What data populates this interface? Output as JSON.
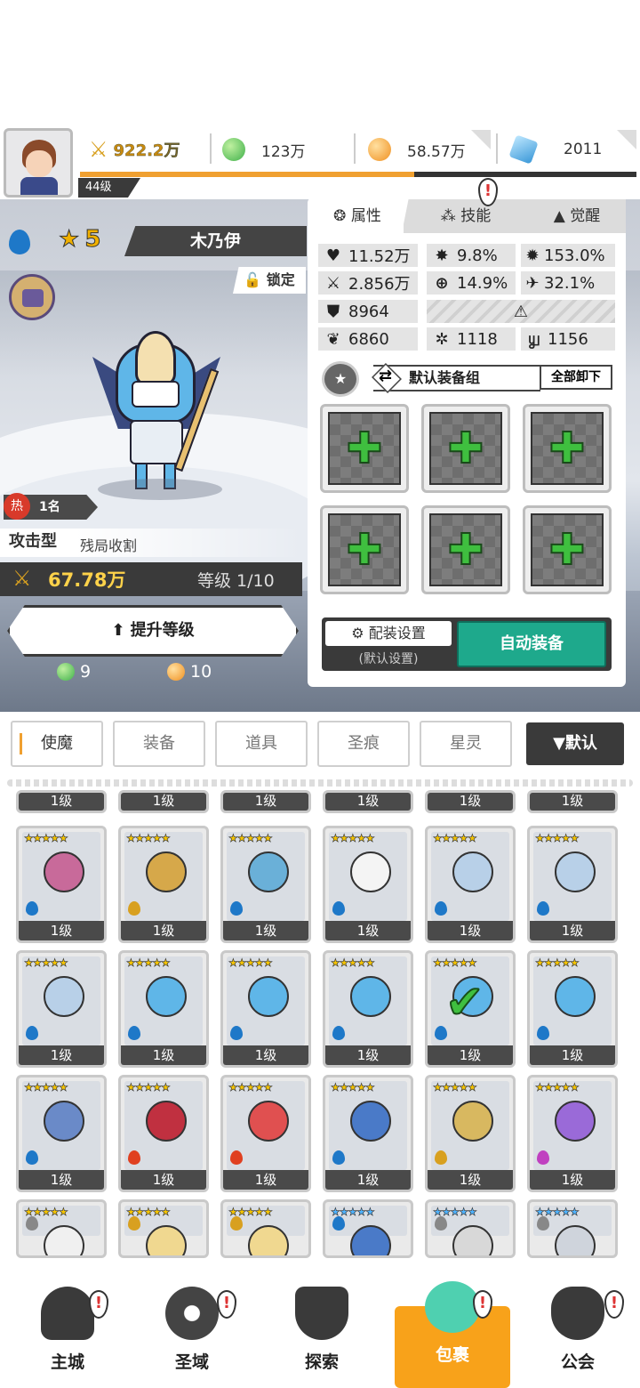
{
  "header": {
    "player_level": "44级",
    "combat_power": "922.2万",
    "green_gem": "123万",
    "gold_coin": "58.57万",
    "crystal": "2011",
    "xp_progress": 0.6
  },
  "hero": {
    "name": "木乃伊",
    "stars": "5",
    "lock_label": "锁定",
    "hot_icon": "热",
    "hot_rank": "1名",
    "type": "攻击型",
    "subtype": "残局收割",
    "power": "67.78万",
    "level_text": "等级 1/10",
    "upgrade_label": "提升等级",
    "cost_green": "9",
    "cost_gold": "10"
  },
  "panel": {
    "tabs": [
      "属性",
      "技能",
      "觉醒"
    ],
    "stats": {
      "hp": "11.52万",
      "crit": "9.8%",
      "crit_dmg": "153.0%",
      "attack": "2.856万",
      "accuracy": "14.9%",
      "speed_pct": "32.1%",
      "defense": "8964",
      "stat_a": "6860",
      "stat_b": "1118",
      "stat_c": "1156"
    },
    "equip_group": "默认装备组",
    "unequip_all": "全部卸下",
    "config_label": "配装设置",
    "config_sub": "(默认设置)",
    "auto_equip": "自动装备"
  },
  "bag": {
    "tabs": [
      "使魔",
      "装备",
      "道具",
      "圣痕",
      "星灵"
    ],
    "sort_label": "▼默认",
    "card_level": "1级"
  },
  "nav": {
    "items": [
      "主城",
      "圣域",
      "探索",
      "包裹",
      "公会"
    ]
  },
  "colors": {
    "accent": "#f8a21a",
    "auto_btn": "#1ea98c",
    "dark": "#3a3a3a",
    "power_text": "#ffd24a"
  }
}
